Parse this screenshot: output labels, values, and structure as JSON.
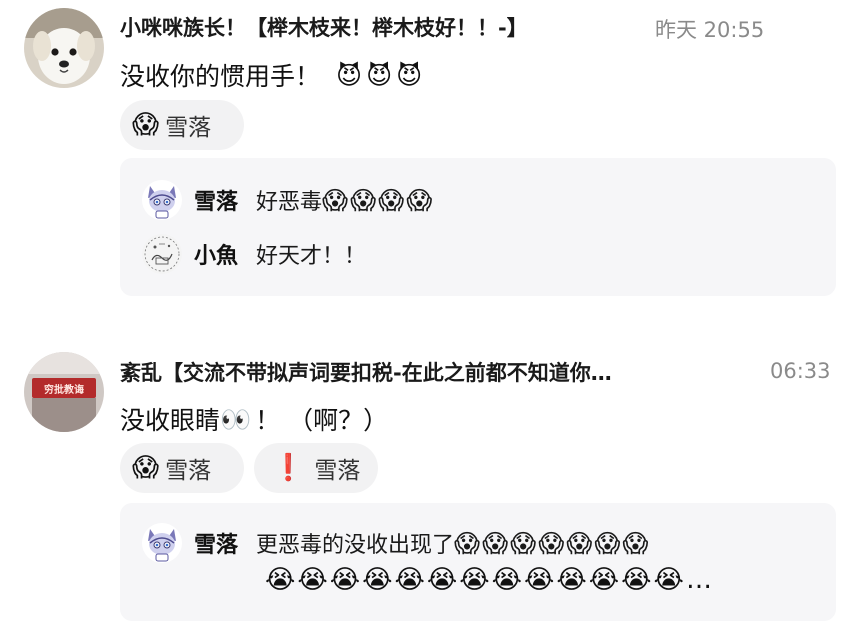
{
  "messages": [
    {
      "author": "小咪咪族长！【榉木枝来！榉木枝好！！-】",
      "time": "昨天 20:55",
      "text": "没收你的惯用手！",
      "text_emojis": "😈😈😈",
      "reactions": [
        {
          "emoji": "😱",
          "user": "雪落"
        }
      ],
      "replies": [
        {
          "user": "雪落",
          "text": "好恶毒",
          "emojis": "😱😱😱😱"
        },
        {
          "user": "小魚",
          "text": "好天才！！",
          "emojis": ""
        }
      ]
    },
    {
      "author": "紊乱【交流不带拟声词要扣税-在此之前都不知道你…",
      "time": "06:33",
      "text": "没收眼睛",
      "text_emoji": "👀",
      "text_after": "！ （啊？）",
      "reactions": [
        {
          "emoji": "😱",
          "user": "雪落"
        },
        {
          "emoji": "❗",
          "user": "雪落"
        }
      ],
      "replies": [
        {
          "user": "雪落",
          "text": "更恶毒的没收出现了",
          "emojis": "😱😱😱😱😱😱😱",
          "emojis_line2": "😭😭😭😭😭😭😭😭😭😭😭😭😭…"
        }
      ]
    }
  ],
  "avatar_images": {
    "msg1": "white-puppy-photo",
    "msg2": "red-sign-photo-text",
    "reply_xueluo": "cartoon-cat-icon",
    "reply_xiaoyu": "sketch-drawing-icon"
  },
  "avatar_sign_text": "穷批教诲",
  "colors": {
    "thread_bg": "#f6f6f8",
    "reaction_bg": "#f2f2f3",
    "time_gray": "#8a8a8a",
    "bang_red": "#e0202a"
  }
}
